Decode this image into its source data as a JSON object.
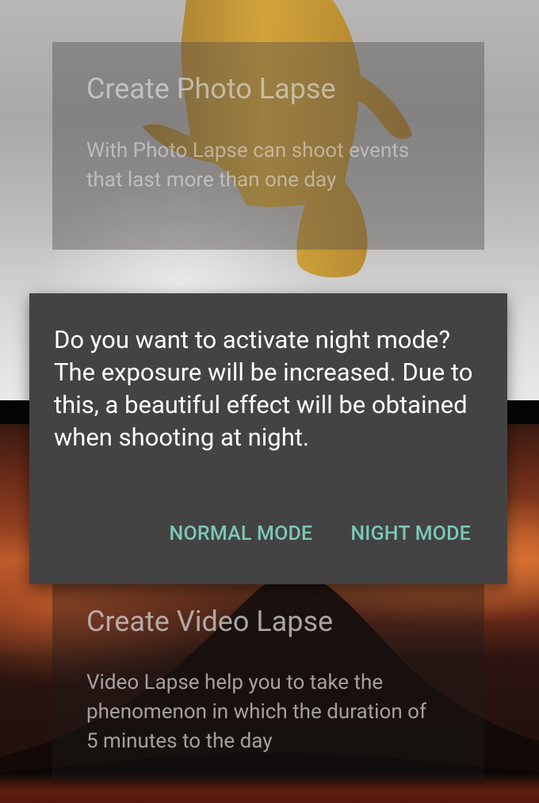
{
  "cards": {
    "photo_lapse": {
      "title": "Create Photo Lapse",
      "description": "With Photo Lapse can shoot events that last more than one day"
    },
    "video_lapse": {
      "title": "Create Video Lapse",
      "description": "Video Lapse help you to take the phenomenon in which the duration of 5 minutes to the day"
    }
  },
  "dialog": {
    "message": "Do you want to activate night mode? The exposure will be increased. Due to this, a beautiful effect will be obtained when shooting at night.",
    "buttons": {
      "normal_mode": "NORMAL MODE",
      "night_mode": "NIGHT MODE"
    }
  },
  "colors": {
    "dialog_background": "#434343",
    "dialog_text": "#ffffff",
    "button_accent": "#7cc8b8"
  }
}
